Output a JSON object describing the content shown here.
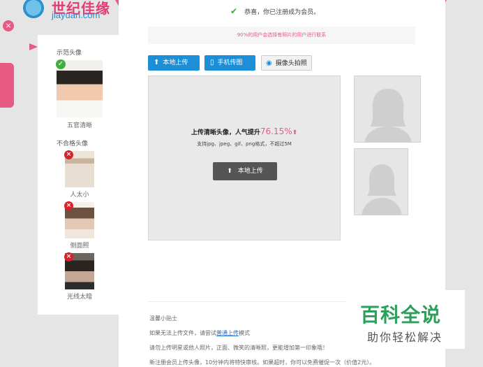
{
  "logo": {
    "text_cn": "世纪佳缘",
    "text_en": "jiayuan.com"
  },
  "header": {
    "success_msg": "恭喜，你已注册成为会员。"
  },
  "notice": "90%的用户会选择有照片的用户进行联系",
  "upload_buttons": {
    "local": "本地上传",
    "phone": "手机传图",
    "camera": "摄像头拍照"
  },
  "upload_area": {
    "headline": "上传清晰头像，人气提升",
    "percent": "76.15%",
    "arrow": "⬆",
    "formats": "支持jpg、jpeg、gif、png格式，不超过5M",
    "button": "本地上传"
  },
  "left_panel": {
    "sample_title": "示范头像",
    "sample_caption": "五官清晰",
    "bad_title": "不合格头像",
    "bad_items": [
      {
        "caption": "人太小"
      },
      {
        "caption": "侧面照"
      },
      {
        "caption": "光线太暗"
      }
    ]
  },
  "tips": {
    "title": "温馨小贴士",
    "line1_pre": "如果无法上传文件，请尝试",
    "line1_link": "普通上传",
    "line1_post": "模式",
    "line2": "请勿上传明星或他人照片，正面、微笑的清晰照，更能增加第一印象哦！",
    "line3": "新注册会员上传头像，10分钟内将特快审核。如果超时，你可以免费催促一次（价值2元）。"
  },
  "watermark": {
    "main": "百科全说",
    "sub": "助你轻松解决"
  },
  "colors": {
    "brand_pink": "#e75a84",
    "brand_blue": "#1d8ed8",
    "success_green": "#3aa63a"
  }
}
